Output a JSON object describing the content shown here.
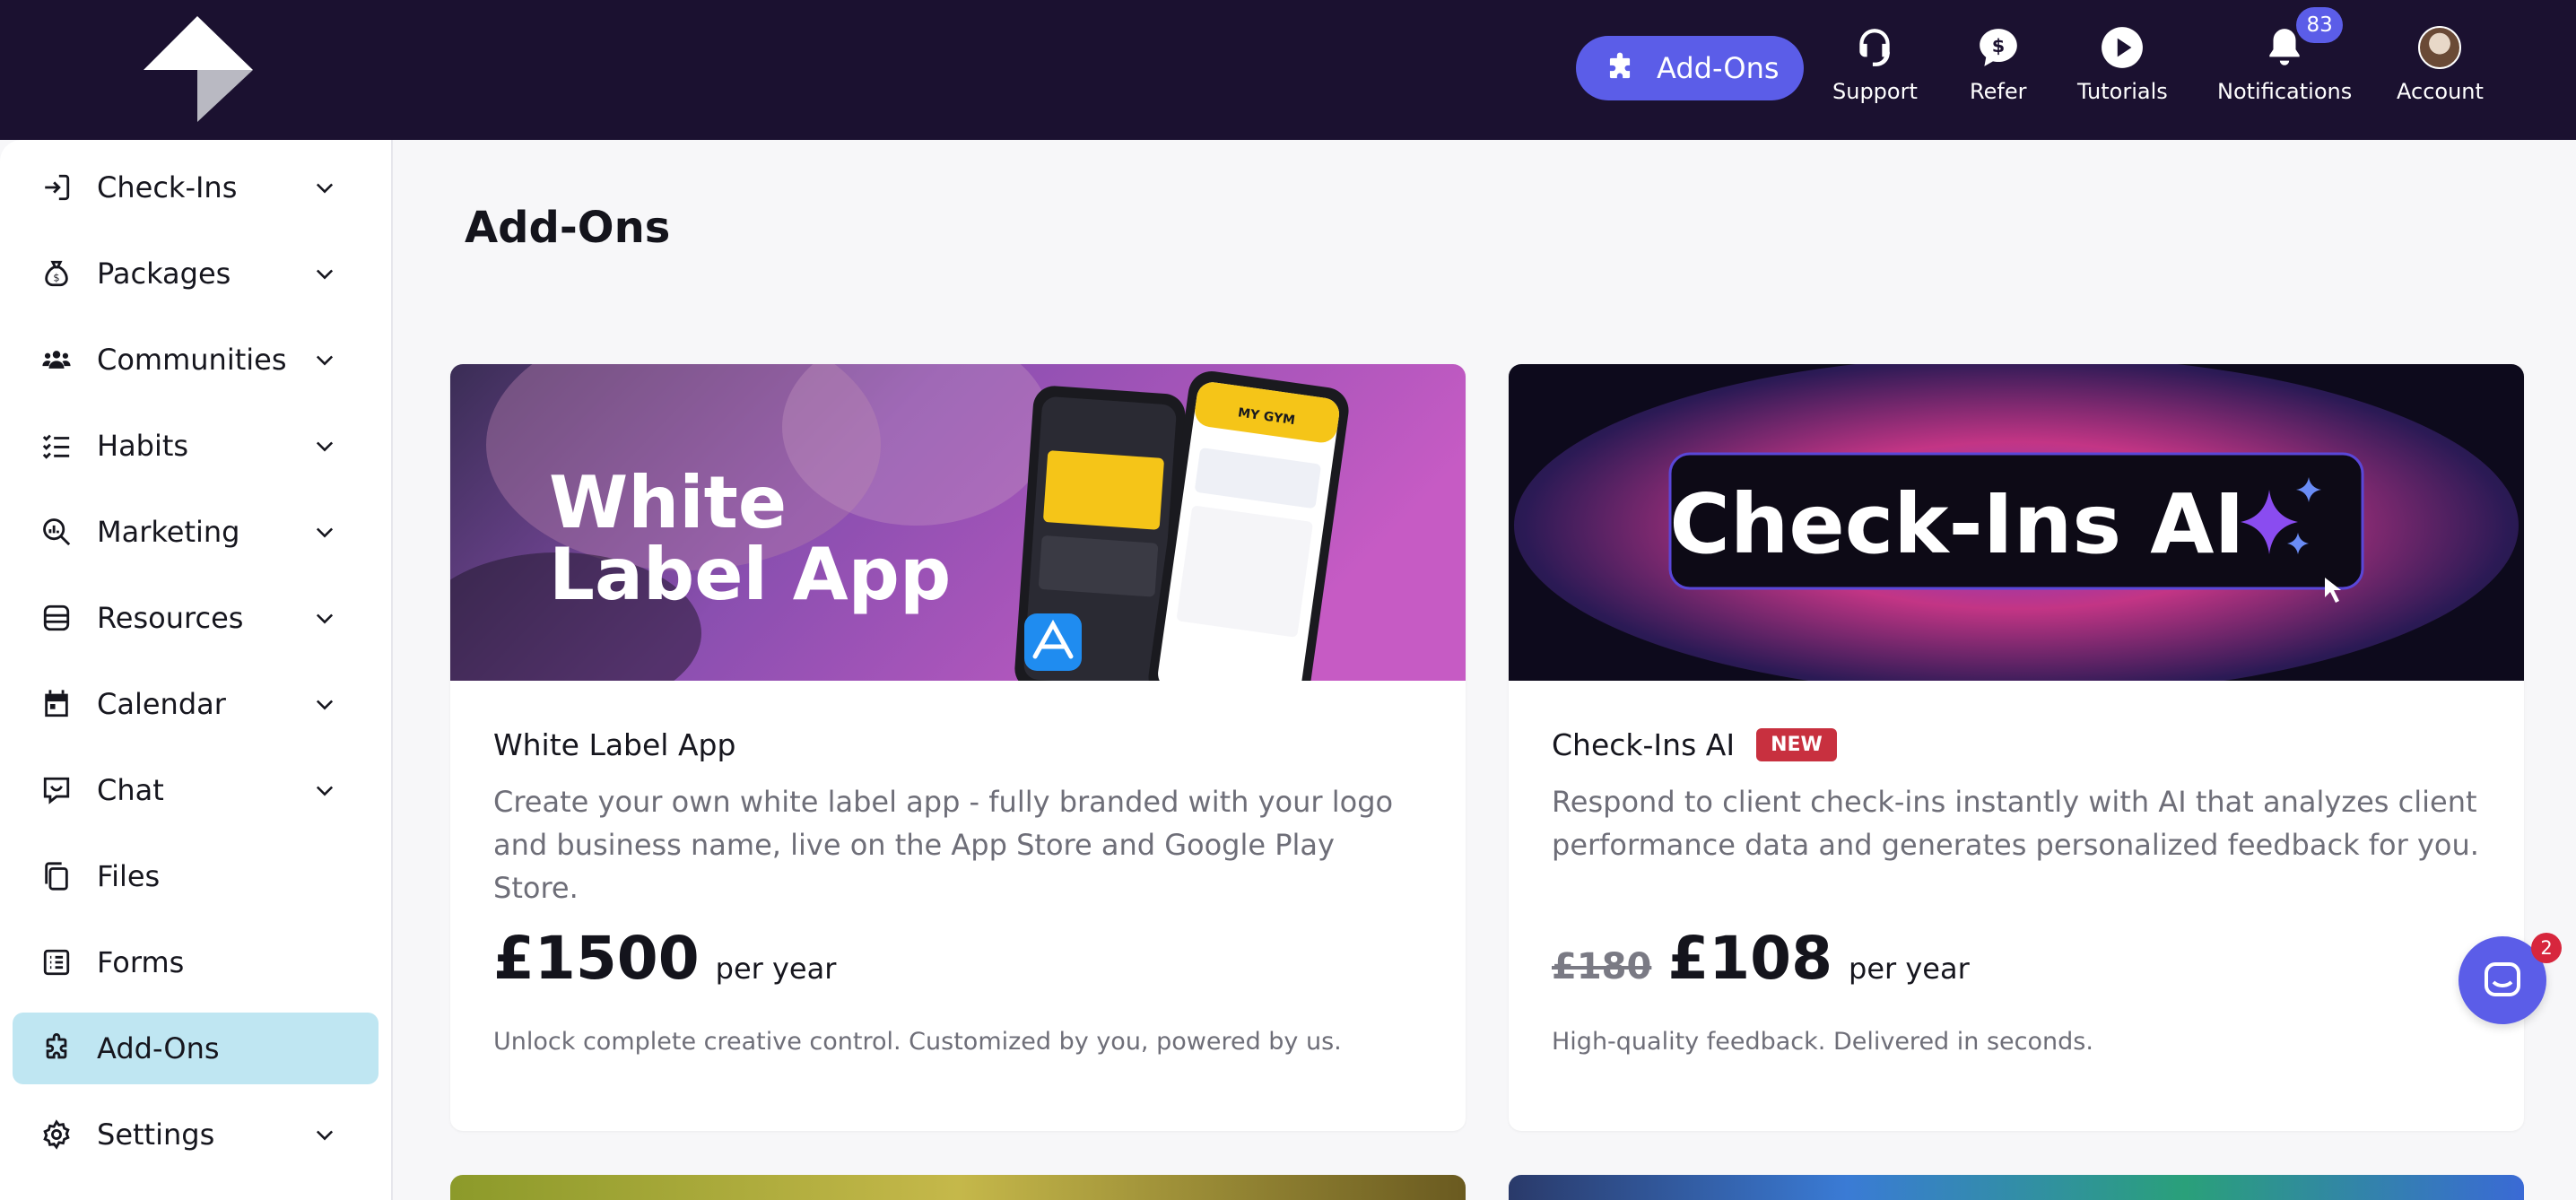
{
  "topbar": {
    "addons_label": "Add-Ons",
    "items": [
      {
        "label": "Support",
        "icon": "headset-icon"
      },
      {
        "label": "Refer",
        "icon": "dollar-bubble-icon"
      },
      {
        "label": "Tutorials",
        "icon": "play-icon"
      },
      {
        "label": "Notifications",
        "icon": "bell-icon",
        "badge": "83"
      },
      {
        "label": "Account",
        "icon": "avatar"
      }
    ],
    "accent": "#5b5de8",
    "background": "#1b1130"
  },
  "sidebar": {
    "items": [
      {
        "label": "Check-Ins",
        "icon": "check-in-icon",
        "expandable": true
      },
      {
        "label": "Packages",
        "icon": "money-bag-icon",
        "expandable": true
      },
      {
        "label": "Communities",
        "icon": "people-icon",
        "expandable": true
      },
      {
        "label": "Habits",
        "icon": "checklist-icon",
        "expandable": true
      },
      {
        "label": "Marketing",
        "icon": "magnify-chart-icon",
        "expandable": true
      },
      {
        "label": "Resources",
        "icon": "database-icon",
        "expandable": true
      },
      {
        "label": "Calendar",
        "icon": "calendar-icon",
        "expandable": true
      },
      {
        "label": "Chat",
        "icon": "chat-icon",
        "expandable": true
      },
      {
        "label": "Files",
        "icon": "files-icon",
        "expandable": false
      },
      {
        "label": "Forms",
        "icon": "form-icon",
        "expandable": false
      },
      {
        "label": "Add-Ons",
        "icon": "puzzle-icon",
        "expandable": false,
        "active": true
      },
      {
        "label": "Settings",
        "icon": "gear-icon",
        "expandable": true
      }
    ],
    "active_color": "#bfe6f2"
  },
  "main": {
    "title": "Add-Ons",
    "cards": [
      {
        "image_text_line1": "White",
        "image_text_line2": "Label App",
        "title": "White Label App",
        "badge": "",
        "description": "Create your own white label app - fully branded with your logo and business name, live on the App Store and Google Play Store.",
        "old_price": "",
        "price": "£1500",
        "per": "per year",
        "tagline": "Unlock complete creative control. Customized by you, powered by us.",
        "phone_header": "MY GYM"
      },
      {
        "image_text": "Check-Ins AI",
        "title": "Check-Ins AI",
        "badge": "NEW",
        "description": "Respond to client check-ins instantly with AI that analyzes client performance data and generates personalized feedback for you.",
        "old_price": "£180",
        "price": "£108",
        "per": "per year",
        "tagline": "High-quality feedback. Delivered in seconds."
      }
    ]
  },
  "chat_widget": {
    "badge": "2"
  }
}
